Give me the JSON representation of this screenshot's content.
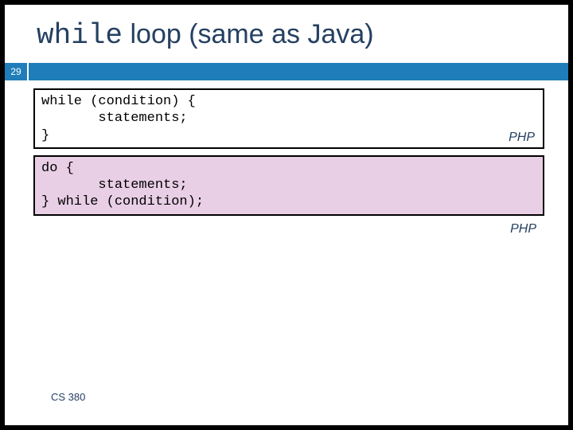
{
  "title_mono": "while",
  "title_rest": " loop (same as Java)",
  "slide_number": "29",
  "code1": "while (condition) {\n       statements;\n}",
  "code1_lang": "PHP",
  "code2": "do {\n       statements;\n} while (condition);",
  "code2_lang": "PHP",
  "footer": "CS 380"
}
